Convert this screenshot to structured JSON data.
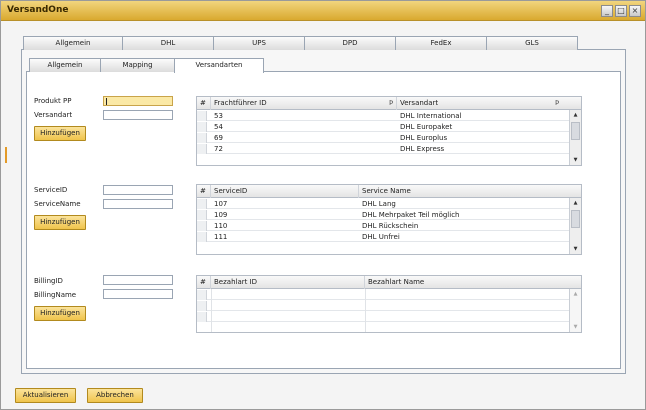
{
  "window": {
    "title": "VersandOne",
    "controls": [
      "_",
      "□",
      "×"
    ]
  },
  "main_tabs": [
    {
      "label": "Allgemein",
      "w": 100
    },
    {
      "label": "DHL",
      "w": 92
    },
    {
      "label": "UPS",
      "w": 92
    },
    {
      "label": "DPD",
      "w": 92
    },
    {
      "label": "FedEx",
      "w": 92
    },
    {
      "label": "GLS",
      "w": 92
    }
  ],
  "sub_tabs": [
    {
      "label": "Allgemein",
      "w": 72
    },
    {
      "label": "Mapping",
      "w": 75
    },
    {
      "label": "Versandarten",
      "w": 90
    }
  ],
  "produkt": {
    "label_pp": "Produkt PP",
    "label_versandart": "Versandart",
    "button": "Hinzufügen"
  },
  "service": {
    "label_id": "ServiceID",
    "label_name": "ServiceName",
    "button": "Hinzufügen"
  },
  "billing": {
    "label_id": "BillingID",
    "label_name": "BillingName",
    "button": "Hinzufügen"
  },
  "grid1": {
    "headers": [
      "#",
      "Frachtführer ID",
      "Versandart"
    ],
    "rows": [
      [
        "53",
        "DHL International"
      ],
      [
        "54",
        "DHL Europaket"
      ],
      [
        "69",
        "DHL Europlus"
      ],
      [
        "72",
        "DHL Express"
      ]
    ]
  },
  "grid2": {
    "headers": [
      "#",
      "ServiceID",
      "Service Name"
    ],
    "rows": [
      [
        "107",
        "DHL Lang"
      ],
      [
        "109",
        "DHL Mehrpaket Teil möglich"
      ],
      [
        "110",
        "DHL Rückschein"
      ],
      [
        "111",
        "DHL Unfrei"
      ]
    ]
  },
  "grid3": {
    "headers": [
      "#",
      "Bezahlart ID",
      "Bezahlart Name"
    ],
    "rows": [
      [
        "",
        ""
      ],
      [
        "",
        ""
      ],
      [
        "",
        ""
      ]
    ]
  },
  "footer": {
    "update": "Aktualisieren",
    "cancel": "Abbrechen"
  },
  "colors": {
    "accent": "#f0c44c",
    "title_bar": "#d9a92f",
    "highlight_field": "#fbe9a6"
  }
}
